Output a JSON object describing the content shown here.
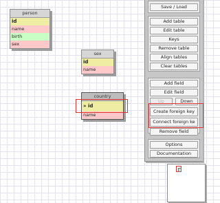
{
  "tables": {
    "person": {
      "title": "person",
      "rows": [
        {
          "label": "id"
        },
        {
          "label": "name"
        },
        {
          "label": "birth"
        },
        {
          "label": "sex"
        }
      ]
    },
    "sex": {
      "title": "sex",
      "rows": [
        {
          "label": "id"
        },
        {
          "label": "name"
        }
      ]
    },
    "country": {
      "title": "country",
      "rows": [
        {
          "label": "» id"
        },
        {
          "label": "name"
        }
      ]
    }
  },
  "panel": {
    "save_load": "Save / Load",
    "add_table": "Add table",
    "edit_table": "Edit table",
    "keys": "Keys",
    "remove_table": "Remove table",
    "align_tables": "Align tables",
    "clear_tables": "Clear tables",
    "add_field": "Add field",
    "edit_field": "Edit field",
    "up": "Up",
    "down": "Down",
    "create_foreign_key": "Create foreign key",
    "connect_foreign_key": "Connect foreign ke",
    "remove_field": "Remove field",
    "options": "Options",
    "documentation": "Documentation"
  },
  "colors": {
    "primary_key_row": "#efeda3",
    "text_field_row": "#ffc9c9",
    "int_field_row": "#c9ffc4",
    "highlight": "#e53030"
  }
}
